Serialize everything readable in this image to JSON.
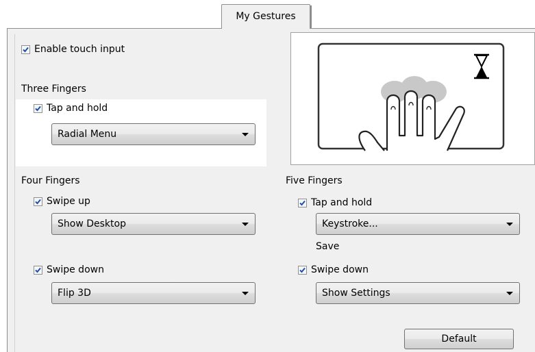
{
  "tab": {
    "label": "My Gestures"
  },
  "enable": {
    "label": "Enable touch input",
    "checked": true
  },
  "three_fingers": {
    "heading": "Three Fingers",
    "tap_hold": {
      "label": "Tap and hold",
      "checked": true,
      "action": "Radial Menu"
    }
  },
  "four_fingers": {
    "heading": "Four Fingers",
    "swipe_up": {
      "label": "Swipe up",
      "checked": true,
      "action": "Show Desktop"
    },
    "swipe_down": {
      "label": "Swipe down",
      "checked": true,
      "action": "Flip 3D"
    }
  },
  "five_fingers": {
    "heading": "Five Fingers",
    "tap_hold": {
      "label": "Tap and hold",
      "checked": true,
      "action": "Keystroke...",
      "sub_label": "Save"
    },
    "swipe_down": {
      "label": "Swipe down",
      "checked": true,
      "action": "Show Settings"
    }
  },
  "illustration": {
    "icons": [
      "hourglass-icon",
      "hand-icon",
      "touchpad-icon"
    ]
  },
  "buttons": {
    "default": "Default"
  }
}
